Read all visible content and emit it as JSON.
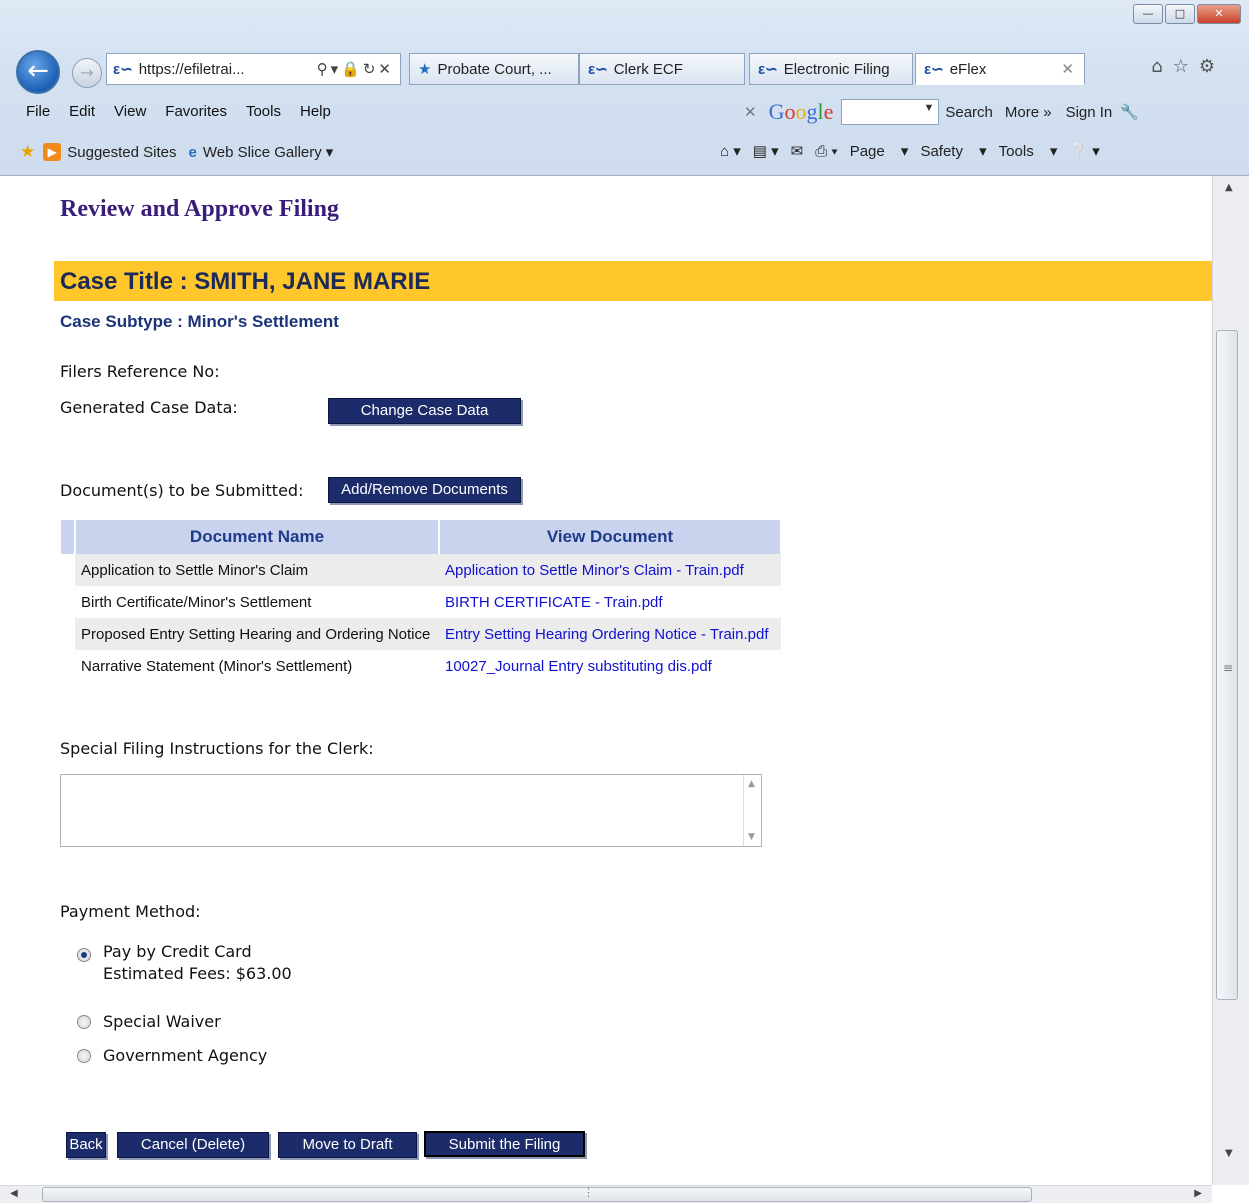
{
  "browser": {
    "address": "https://efiletrai...",
    "tabs": [
      {
        "label": "Probate Court, ..."
      },
      {
        "label": "Clerk ECF"
      },
      {
        "label": "Electronic Filing"
      },
      {
        "label": "eFlex"
      }
    ],
    "menu": [
      "File",
      "Edit",
      "View",
      "Favorites",
      "Tools",
      "Help"
    ],
    "google": {
      "logo": "Google",
      "search_label": "Search",
      "more_label": "More »",
      "signin_label": "Sign In"
    },
    "favorites": {
      "suggested_sites": "Suggested Sites",
      "web_slice_gallery": "Web Slice Gallery"
    },
    "commands": {
      "page": "Page",
      "safety": "Safety",
      "tools": "Tools"
    }
  },
  "page": {
    "heading": "Review and Approve Filing",
    "case_title": "Case Title : SMITH, JANE MARIE",
    "case_subtype": "Case Subtype : Minor's Settlement",
    "filers_ref_label": "Filers Reference No:",
    "generated_case_label": "Generated Case Data:",
    "change_case_button": "Change Case Data",
    "documents_label": "Document(s) to be Submitted:",
    "add_remove_button": "Add/Remove Documents",
    "table": {
      "headers": [
        "Document Name",
        "View Document"
      ],
      "rows": [
        {
          "name": "Application to Settle Minor's Claim",
          "link": "Application to Settle Minor's Claim - Train.pdf"
        },
        {
          "name": "Birth Certificate/Minor's Settlement",
          "link": "BIRTH CERTIFICATE - Train.pdf"
        },
        {
          "name": "Proposed Entry Setting Hearing and Ordering Notice",
          "link": "Entry Setting Hearing Ordering Notice - Train.pdf"
        },
        {
          "name": "Narrative Statement (Minor's Settlement)",
          "link": "10027_Journal Entry substituting dis.pdf"
        }
      ]
    },
    "instructions_label": "Special Filing Instructions for the Clerk:",
    "instructions_value": "",
    "payment": {
      "label": "Payment Method:",
      "options": [
        {
          "label": "Pay by Credit Card",
          "checked": true
        },
        {
          "label": "Special Waiver",
          "checked": false
        },
        {
          "label": "Government Agency",
          "checked": false
        }
      ],
      "estimated_fees": "Estimated Fees: $63.00"
    },
    "buttons": {
      "back": "Back",
      "cancel": "Cancel (Delete)",
      "draft": "Move to Draft",
      "submit": "Submit the Filing"
    }
  }
}
